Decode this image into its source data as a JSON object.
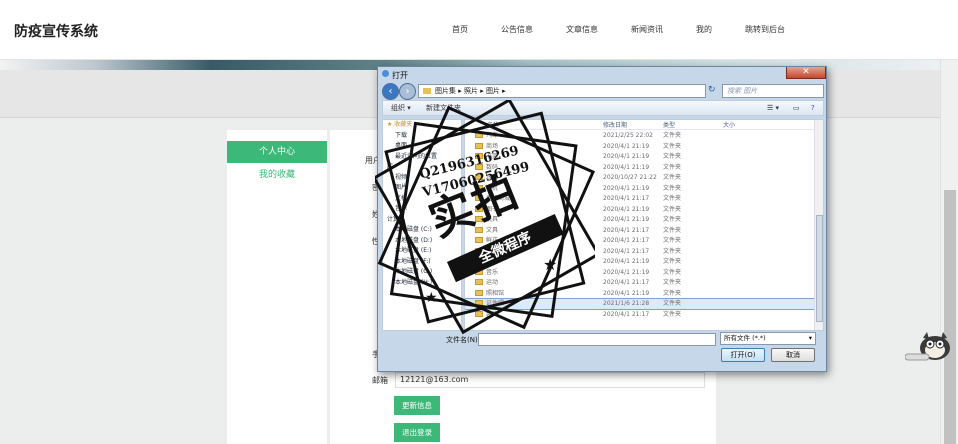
{
  "header": {
    "logo": "防疫宣传系统",
    "nav": [
      "首页",
      "公告信息",
      "文章信息",
      "新闻资讯",
      "我的",
      "跳转到后台"
    ]
  },
  "sidebar": {
    "active": "个人中心",
    "item": "我的收藏"
  },
  "form": {
    "labels": {
      "a": "用户",
      "b": "密",
      "c": "姓",
      "d": "性",
      "e": "手",
      "email": "邮箱"
    },
    "email_value": "12121@163.com",
    "update_button": "更新信息",
    "logout_button": "退出登录"
  },
  "dialog": {
    "title": "打开",
    "close": "✕",
    "path": [
      "图片集",
      "照片",
      "图片"
    ],
    "search_placeholder": "搜索 图片",
    "toolbar": {
      "organize": "组织 ▾",
      "new_folder": "新建文件夹"
    },
    "tree": [
      "收藏夹",
      "下载",
      "桌面",
      "最近访问的位置",
      "库",
      "视频",
      "图片",
      "文档",
      "音乐",
      "计算机",
      "本地磁盘 (C:)",
      "本地磁盘 (D:)",
      "本地磁盘 (E:)",
      "本地磁盘 (F:)",
      "本地磁盘 (G:)",
      "本地磁盘 (H:)"
    ],
    "columns": {
      "name": "名称",
      "date": "修改日期",
      "type": "类型",
      "size": "大小"
    },
    "files": [
      {
        "name": "汽车",
        "date": "2021/2/25 22:02",
        "type": "文件夹"
      },
      {
        "name": "商场",
        "date": "2020/4/1 21:19",
        "type": "文件夹"
      },
      {
        "name": "书架",
        "date": "2020/4/1 21:19",
        "type": "文件夹"
      },
      {
        "name": "数码",
        "date": "2020/4/1 21:19",
        "type": "文件夹"
      },
      {
        "name": "水果",
        "date": "2020/10/27 21:22",
        "type": "文件夹"
      },
      {
        "name": "手机",
        "date": "2020/4/1 21:19",
        "type": "文件夹"
      },
      {
        "name": "手机商城",
        "date": "2020/4/1 21:17",
        "type": "文件夹"
      },
      {
        "name": "图书",
        "date": "2020/4/1 21:19",
        "type": "文件夹"
      },
      {
        "name": "玩具",
        "date": "2020/4/1 21:19",
        "type": "文件夹"
      },
      {
        "name": "文具",
        "date": "2020/4/1 21:17",
        "type": "文件夹"
      },
      {
        "name": "鲜花",
        "date": "2020/4/1 21:17",
        "type": "文件夹"
      },
      {
        "name": "演出",
        "date": "2020/4/1 21:17",
        "type": "文件夹"
      },
      {
        "name": "药品",
        "date": "2020/4/1 21:19",
        "type": "文件夹"
      },
      {
        "name": "音乐",
        "date": "2020/4/1 21:19",
        "type": "文件夹"
      },
      {
        "name": "运动",
        "date": "2020/4/1 21:17",
        "type": "文件夹"
      },
      {
        "name": "照相馆",
        "date": "2020/4/1 21:19",
        "type": "文件夹"
      },
      {
        "name": "证件照",
        "date": "2021/1/6 21:28",
        "type": "文件夹"
      },
      {
        "name": "装饰",
        "date": "2020/4/1 21:17",
        "type": "文件夹"
      }
    ],
    "filename_label": "文件名(N):",
    "filetype": "所有文件 (*.*)",
    "open_button": "打开(O)",
    "cancel_button": "取消"
  },
  "watermark": {
    "line1": "Q2196316269",
    "line2": "V17060256499",
    "big": "实拍",
    "ribbon": "全微程序"
  },
  "colors": {
    "accent": "#3cb878",
    "dialog_frame": "#c6d7ea"
  }
}
